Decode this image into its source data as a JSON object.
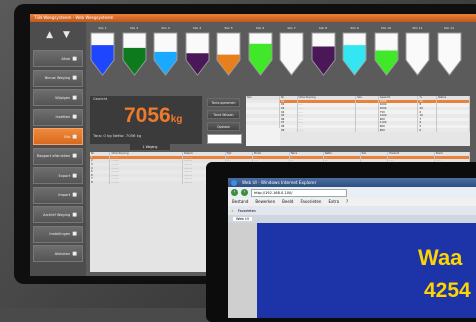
{
  "main_app": {
    "title": "TSN Weegsysteem - Web Weegsysteem",
    "sidebar": [
      {
        "label": "Afval",
        "icon": "bag-icon"
      },
      {
        "label": "Nieuw Weging",
        "icon": "scale-icon"
      },
      {
        "label": "Wijzigen",
        "icon": "edit-icon"
      },
      {
        "label": "Inzetten",
        "icon": "drop-icon"
      },
      {
        "label": "Silo",
        "icon": "silo-icon",
        "active": true
      },
      {
        "label": "Rapport afdrukken",
        "icon": "printer-icon"
      },
      {
        "label": "Export",
        "icon": "export-icon"
      },
      {
        "label": "Import",
        "icon": "import-icon"
      },
      {
        "label": "Archief Weging",
        "icon": "archive-icon"
      },
      {
        "label": "Instellingen",
        "icon": "filter-icon"
      },
      {
        "label": "Afsluiten",
        "icon": "power-icon"
      }
    ],
    "silos": [
      {
        "label": "Silo 1",
        "color": "#1f46ff",
        "fill": 0.55
      },
      {
        "label": "Silo 2",
        "color": "#0d7a1e",
        "fill": 0.45
      },
      {
        "label": "Silo 3",
        "color": "#1ba8ff",
        "fill": 0.3
      },
      {
        "label": "Silo 4",
        "color": "#4a1858",
        "fill": 0.25
      },
      {
        "label": "Silo 5",
        "color": "#e7801c",
        "fill": 0.2
      },
      {
        "label": "Silo 6",
        "color": "#41e82a",
        "fill": 0.6
      },
      {
        "label": "Silo 7",
        "color": "#ffffff",
        "fill": 0
      },
      {
        "label": "Silo 8",
        "color": "#4a1858",
        "fill": 0.5
      },
      {
        "label": "Silo 9",
        "color": "#34e5f2",
        "fill": 0.55
      },
      {
        "label": "Silo 10",
        "color": "#41e82a",
        "fill": 0.35
      },
      {
        "label": "Silo 11",
        "color": "#ffffff",
        "fill": 0
      },
      {
        "label": "Silo 12",
        "color": "#ffffff",
        "fill": 0
      }
    ],
    "weight": {
      "caption": "Gewicht",
      "value": "7056",
      "unit": "kg",
      "tara": "Tara: 0 kg   Netto: 7056 kg"
    },
    "buttons": [
      "Tarra opnemen",
      "Tarra Wissen",
      "Opslaan",
      "1 Weging"
    ],
    "accent": "#e9813a"
  },
  "browser": {
    "title": "Web UI - Windows Internet Explorer",
    "address": "http://192.168.0.100/",
    "menu": [
      "Bestand",
      "Bewerken",
      "Beeld",
      "Favorieten",
      "Extra",
      "?"
    ],
    "fav_label": "Favorieten",
    "tab_label": "Web UI",
    "big_text_1": "Waa",
    "big_text_2": "4254"
  }
}
